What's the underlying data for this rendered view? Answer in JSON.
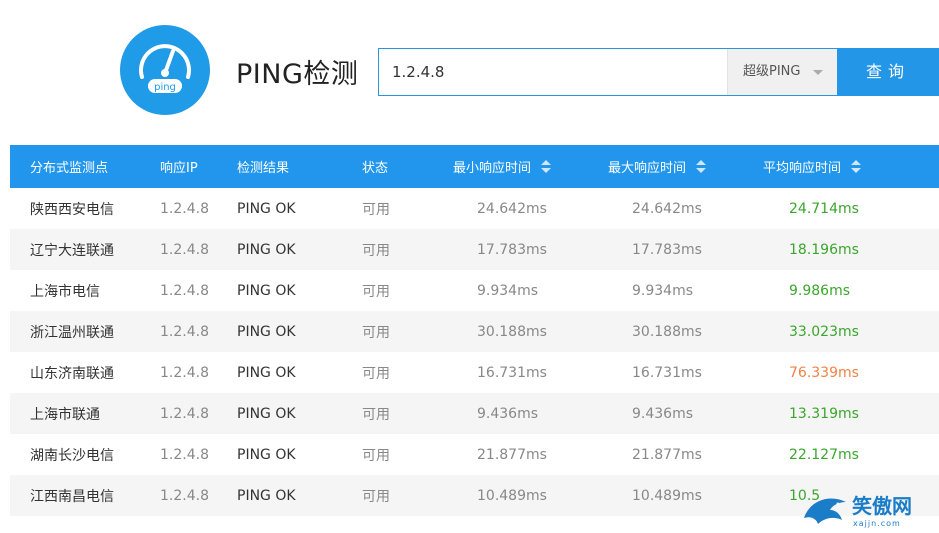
{
  "header": {
    "logo_text": "ping",
    "title": "PING检测"
  },
  "search": {
    "value": "1.2.4.8",
    "type_selected": "超级PING",
    "button_label": "查询"
  },
  "colors": {
    "accent": "#2196ec",
    "good": "#3aa62c",
    "warn": "#ee8347"
  },
  "table": {
    "columns": [
      "分布式监测点",
      "响应IP",
      "检测结果",
      "状态",
      "最小响应时间",
      "最大响应时间",
      "平均响应时间"
    ],
    "rows": [
      {
        "region": "陕西西安电信",
        "ip": "1.2.4.8",
        "result": "PING OK",
        "status": "可用",
        "min": "24.642ms",
        "max": "24.642ms",
        "avg": "24.714ms",
        "level": "good"
      },
      {
        "region": "辽宁大连联通",
        "ip": "1.2.4.8",
        "result": "PING OK",
        "status": "可用",
        "min": "17.783ms",
        "max": "17.783ms",
        "avg": "18.196ms",
        "level": "good"
      },
      {
        "region": "上海市电信",
        "ip": "1.2.4.8",
        "result": "PING OK",
        "status": "可用",
        "min": "9.934ms",
        "max": "9.934ms",
        "avg": "9.986ms",
        "level": "good"
      },
      {
        "region": "浙江温州联通",
        "ip": "1.2.4.8",
        "result": "PING OK",
        "status": "可用",
        "min": "30.188ms",
        "max": "30.188ms",
        "avg": "33.023ms",
        "level": "good"
      },
      {
        "region": "山东济南联通",
        "ip": "1.2.4.8",
        "result": "PING OK",
        "status": "可用",
        "min": "16.731ms",
        "max": "16.731ms",
        "avg": "76.339ms",
        "level": "warn"
      },
      {
        "region": "上海市联通",
        "ip": "1.2.4.8",
        "result": "PING OK",
        "status": "可用",
        "min": "9.436ms",
        "max": "9.436ms",
        "avg": "13.319ms",
        "level": "good"
      },
      {
        "region": "湖南长沙电信",
        "ip": "1.2.4.8",
        "result": "PING OK",
        "status": "可用",
        "min": "21.877ms",
        "max": "21.877ms",
        "avg": "22.127ms",
        "level": "good"
      },
      {
        "region": "江西南昌电信",
        "ip": "1.2.4.8",
        "result": "PING OK",
        "status": "可用",
        "min": "10.489ms",
        "max": "10.489ms",
        "avg": "10.5",
        "level": "good"
      }
    ]
  },
  "watermark": {
    "text": "笑傲网",
    "sub": "xajjn.com"
  }
}
